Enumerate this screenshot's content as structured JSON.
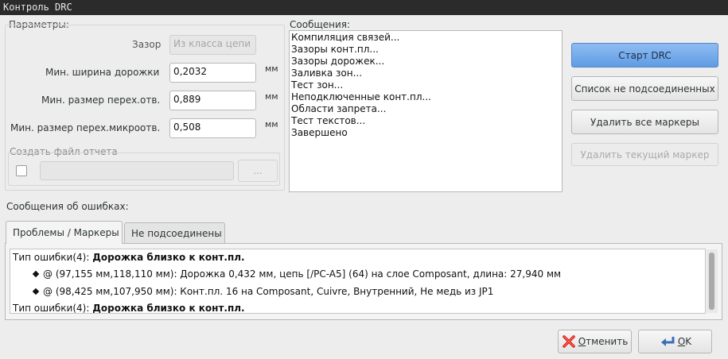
{
  "window": {
    "title": "Контроль DRC"
  },
  "params": {
    "group_title": "Параметры:",
    "clearance_label": "Зазор",
    "clearance_value": "Из класса цепи",
    "min_track_label": "Мин. ширина дорожки",
    "min_track_value": "0,2032",
    "min_via_label": "Мин. размер перех.отв.",
    "min_via_value": "0,889",
    "min_microvia_label": "Мин. размер перех.микроотв.",
    "min_microvia_value": "0,508",
    "unit": "мм",
    "report_group_title": "Создать файл отчета",
    "report_path_value": "",
    "browse_label": "..."
  },
  "messages": {
    "title": "Сообщения:",
    "lines": [
      "Компиляция связей...",
      "Зазоры конт.пл...",
      "Зазоры дорожек...",
      "Заливка зон...",
      "Тест зон...",
      "Неподключенные конт.пл...",
      "Области запрета...",
      "Тест текстов...",
      "Завершено"
    ]
  },
  "actions": {
    "start_drc": "Старт DRC",
    "list_unconnected": "Список не подсоединенных",
    "delete_all_markers": "Удалить все маркеры",
    "delete_current_marker": "Удалить текущий маркер"
  },
  "errors": {
    "title": "Сообщения об ошибках:",
    "tabs": [
      "Проблемы / Маркеры",
      "Не подсоединены"
    ],
    "items": [
      {
        "type_prefix": "Тип ошибки(4): ",
        "type_name": "Дорожка близко к конт.пл."
      },
      {
        "detail": "@ (97,155 мм,118,110 мм): Дорожка 0,432 мм, цепь [/PC-A5] (64) на слое Composant, длина: 27,940 мм"
      },
      {
        "detail": "@ (98,425 мм,107,950 мм): Конт.пл. 16 на Composant, Cuivre, Внутренний, Не медь из JP1"
      },
      {
        "type_prefix": "Тип ошибки(4): ",
        "type_name": "Дорожка близко к конт.пл."
      }
    ]
  },
  "footer": {
    "cancel_mnemonic": "О",
    "cancel_rest": "тменить",
    "ok_mnemonic": "O",
    "ok_rest": "K"
  },
  "icons": {
    "cancel": "red-x-icon",
    "ok": "return-arrow-icon"
  }
}
